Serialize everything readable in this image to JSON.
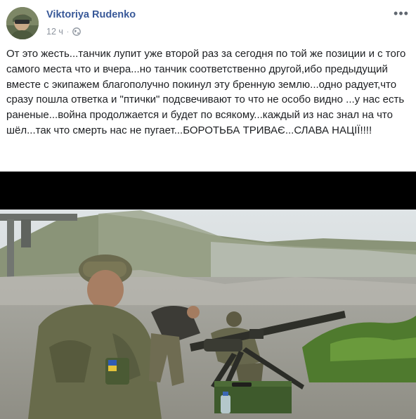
{
  "post": {
    "author": "Viktoriya Rudenko",
    "time": "12 ч",
    "privacy_icon": "globe-icon",
    "more_icon": "more-options-icon",
    "more_label": "•••",
    "text": "От это жесть...танчик лупит уже второй раз за сегодня по той же позиции и с того самого места что и вчера...но танчик соответственно другой,ибо предыдущий вместе с экипажем благополучно покинул эту бренную землю...одно радует,что сразу пошла ответка и \"птички\" подсвечивают то что не особо видно ...у нас есть раненые...война продолжается и будет по всякому...каждый из нас знал на что шёл...так что смерть нас не пугает...БОРОТЬБА ТРИВАЄ...СЛАВА НАЦІЇ!!!!"
  },
  "colors": {
    "author_link": "#385898",
    "meta_gray": "#8d949e",
    "text": "#1c1e21"
  }
}
